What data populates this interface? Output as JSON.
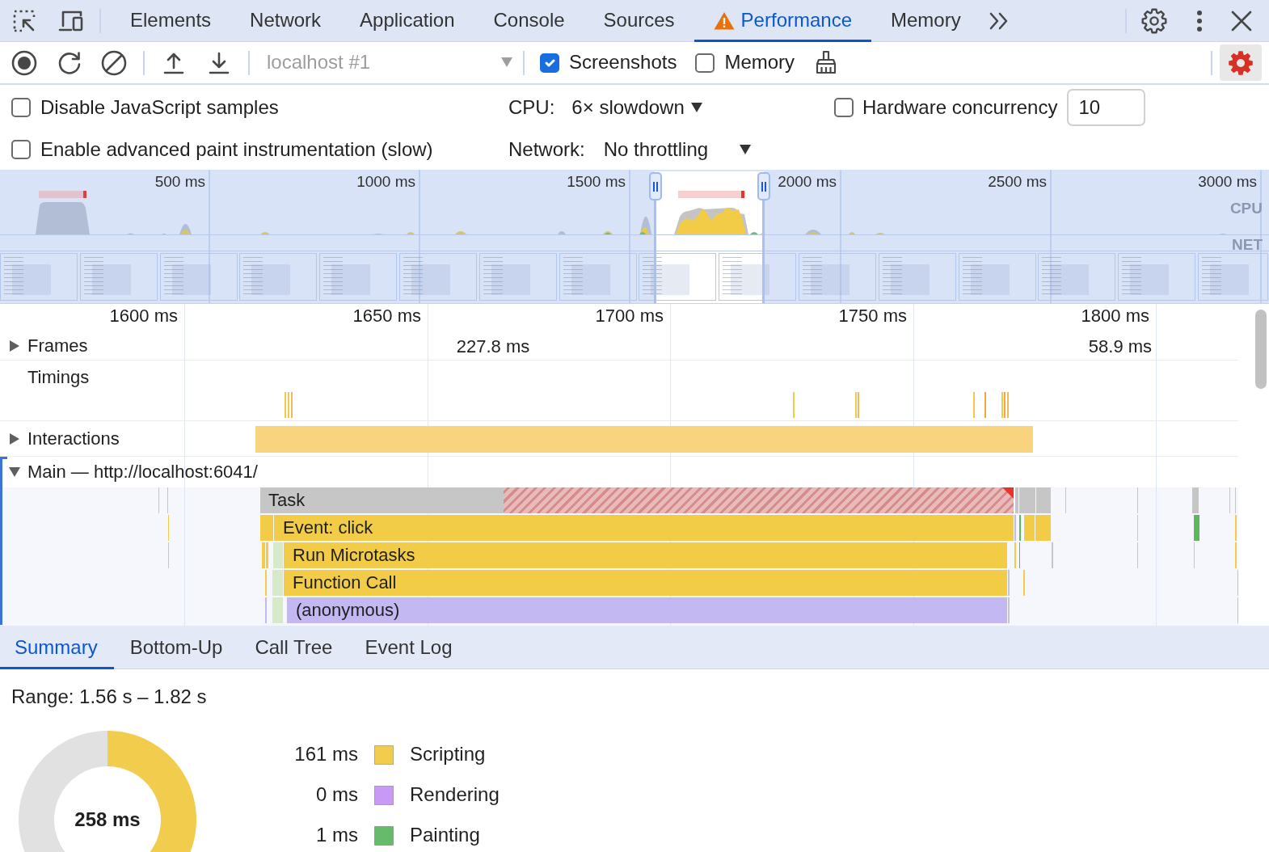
{
  "tabs": [
    {
      "label": "Elements",
      "selected": false
    },
    {
      "label": "Network",
      "selected": false
    },
    {
      "label": "Application",
      "selected": false
    },
    {
      "label": "Console",
      "selected": false
    },
    {
      "label": "Sources",
      "selected": false
    },
    {
      "label": "Performance",
      "selected": true,
      "warning": true
    },
    {
      "label": "Memory",
      "selected": false
    }
  ],
  "toolbar": {
    "target": "localhost #1",
    "checkboxes": [
      {
        "label": "Screenshots",
        "checked": true
      },
      {
        "label": "Memory",
        "checked": false
      }
    ]
  },
  "settings": {
    "checkboxes": [
      {
        "label": "Disable JavaScript samples",
        "checked": false
      },
      {
        "label": "Enable advanced paint instrumentation (slow)",
        "checked": false
      }
    ],
    "cpu": {
      "label": "CPU:",
      "value": "6× slowdown"
    },
    "network": {
      "label": "Network:",
      "value": "No throttling"
    },
    "hardware_concurrency": {
      "label": "Hardware concurrency",
      "checked": false,
      "value": "10"
    }
  },
  "overview": {
    "ticks": [
      "500 ms",
      "1000 ms",
      "1500 ms",
      "2000 ms",
      "2500 ms",
      "3000 ms"
    ],
    "lanes": [
      "CPU",
      "NET"
    ]
  },
  "timeline": {
    "ruler": [
      "1600 ms",
      "1650 ms",
      "1700 ms",
      "1750 ms",
      "1800 ms"
    ],
    "tracks": [
      {
        "kind": "frames",
        "label": "Frames",
        "expanded": false,
        "frame_durations": [
          "227.8 ms",
          "58.9 ms"
        ]
      },
      {
        "kind": "timings",
        "label": "Timings"
      },
      {
        "kind": "interactions",
        "label": "Interactions",
        "expanded": false
      },
      {
        "kind": "thread",
        "label": "Main — http://localhost:6041/",
        "expanded": true,
        "events": [
          {
            "label": "Task",
            "kind": "task",
            "long_task": true
          },
          {
            "label": "Event: click",
            "kind": "scripting"
          },
          {
            "label": "Run Microtasks",
            "kind": "scripting"
          },
          {
            "label": "Function Call",
            "kind": "scripting"
          },
          {
            "label": "(anonymous)",
            "kind": "function"
          }
        ]
      }
    ]
  },
  "bottom_tabs": [
    {
      "label": "Summary",
      "selected": true
    },
    {
      "label": "Bottom-Up",
      "selected": false
    },
    {
      "label": "Call Tree",
      "selected": false
    },
    {
      "label": "Event Log",
      "selected": false
    }
  ],
  "summary": {
    "range": "Range: 1.56 s – 1.82 s",
    "total": "258 ms",
    "legend": [
      {
        "value": "161 ms",
        "color": "#f2cc4c"
      },
      {
        "value": "0 ms",
        "color": "#c89af5"
      },
      {
        "value": "1 ms",
        "label": "Painting",
        "color": "#66bb6a"
      }
    ],
    "chart_data": {
      "type": "donut",
      "categories": [
        "Scripting",
        "Rendering",
        null
      ],
      "values": [
        62.4,
        0,
        37.6
      ]
    }
  }
}
